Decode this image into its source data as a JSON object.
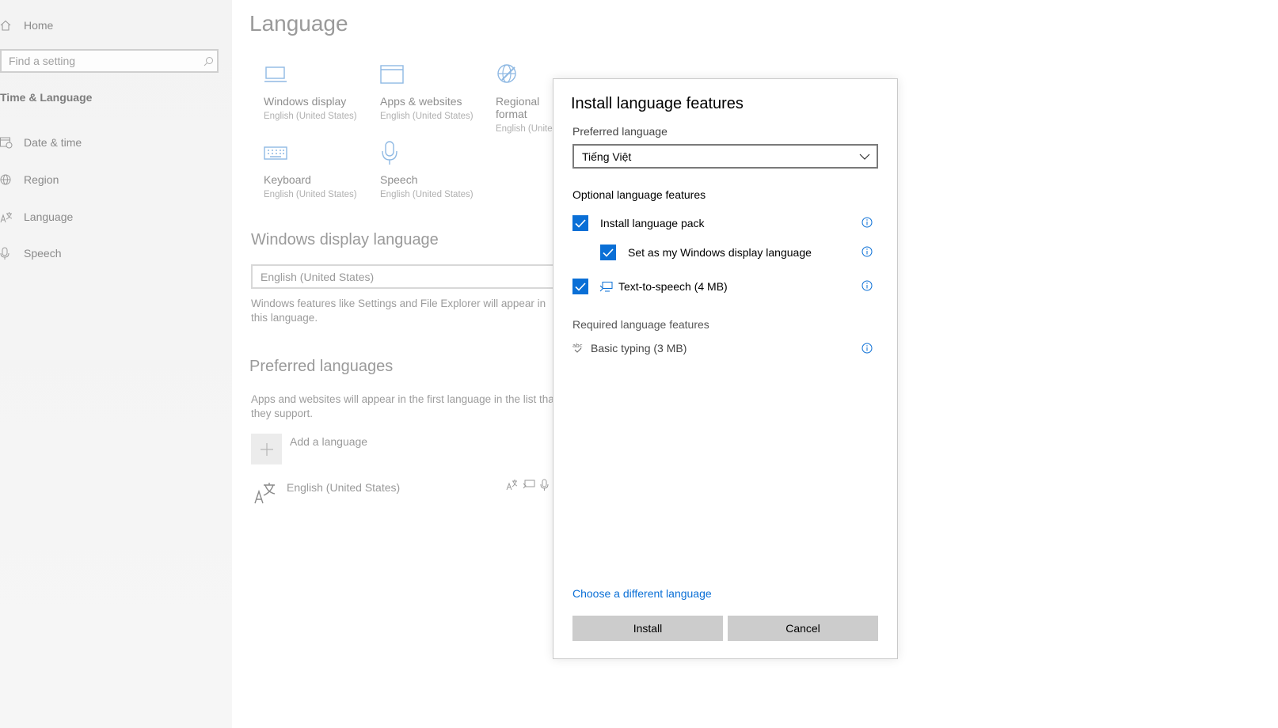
{
  "sidebar": {
    "home_label": "Home",
    "search_placeholder": "Find a setting",
    "section_title": "Time & Language",
    "items": [
      {
        "label": "Date & time",
        "icon": "calendar-clock-icon"
      },
      {
        "label": "Region",
        "icon": "globe-icon"
      },
      {
        "label": "Language",
        "icon": "language-icon"
      },
      {
        "label": "Speech",
        "icon": "microphone-icon"
      }
    ]
  },
  "main": {
    "title": "Language",
    "tiles": [
      {
        "label": "Windows display",
        "sub": "English (United States)",
        "icon": "laptop-icon"
      },
      {
        "label": "Apps & websites",
        "sub": "English (United States)",
        "icon": "window-icon"
      },
      {
        "label": "Regional format",
        "sub": "English (United States)",
        "icon": "globe-pen-icon"
      },
      {
        "label": "Keyboard",
        "sub": "English (United States)",
        "icon": "keyboard-icon"
      },
      {
        "label": "Speech",
        "sub": "English (United States)",
        "icon": "microphone-icon"
      }
    ],
    "display_language": {
      "heading": "Windows display language",
      "selected": "English (United States)",
      "description": "Windows features like Settings and File Explorer will appear in this language."
    },
    "preferred_languages": {
      "heading": "Preferred languages",
      "description": "Apps and websites will appear in the first language in the list that they support.",
      "add_label": "Add a language",
      "languages": [
        {
          "name": "English (United States)"
        }
      ]
    }
  },
  "dialog": {
    "title": "Install language features",
    "preferred_label": "Preferred language",
    "selected_language": "Tiếng Việt",
    "optional_label": "Optional language features",
    "optional": [
      {
        "label": "Install language pack",
        "checked": true
      },
      {
        "label": "Set as my Windows display language",
        "checked": true
      },
      {
        "label": "Text-to-speech (4 MB)",
        "checked": true
      }
    ],
    "required_label": "Required language features",
    "required": [
      {
        "label": "Basic typing (3 MB)"
      }
    ],
    "choose_link": "Choose a different language",
    "install_label": "Install",
    "cancel_label": "Cancel"
  },
  "colors": {
    "accent": "#0a6fd6",
    "button_bg": "#cccccc",
    "dim_text": "#9a9a9a"
  }
}
